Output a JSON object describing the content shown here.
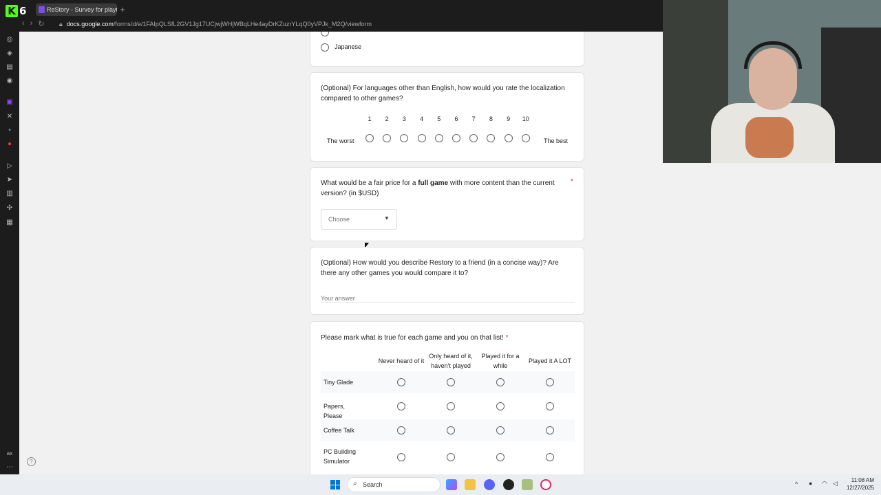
{
  "browser": {
    "logo_text": "6",
    "tab_title": "ReStory - Survey for playte",
    "new_tab": "+",
    "url_domain": "docs.google.com",
    "url_rest": "/forms/d/e/1FAIpQLSfL2GV1Jg17UCjwjWHjWBqLHe4ayDrKZuzrYLqQ0yVPJk_M2Q/viewform"
  },
  "form": {
    "lang_option": "Japanese",
    "loc_question": "(Optional) For languages other than English, how would you rate the localization compared to other games?",
    "scale_numbers": [
      "1",
      "2",
      "3",
      "4",
      "5",
      "6",
      "7",
      "8",
      "9",
      "10"
    ],
    "scale_low": "The worst",
    "scale_high": "The best",
    "price_question_pre": "What would be a fair price for a ",
    "price_question_bold": "full game",
    "price_question_post": " with more content than the current version? (in $USD)",
    "required_mark": "*",
    "choose_placeholder": "Choose",
    "describe_question": "(Optional)  How would you describe Restory to a friend (in a concise way)? Are there any other games you would compare it to?",
    "answer_placeholder": "Your answer",
    "grid_question": "Please mark what is true for each game and you on that list!",
    "grid_columns": [
      "Never heard of it",
      "Only heard of it, haven't played",
      "Played it for a while",
      "Played it A LOT"
    ],
    "grid_rows": [
      "Tiny Glade",
      "Papers, Please",
      "Coffee Talk",
      "PC Building Simulator"
    ]
  },
  "taskbar": {
    "search_label": "Search",
    "time": "11:08 AM",
    "date": "12/27/2025"
  }
}
